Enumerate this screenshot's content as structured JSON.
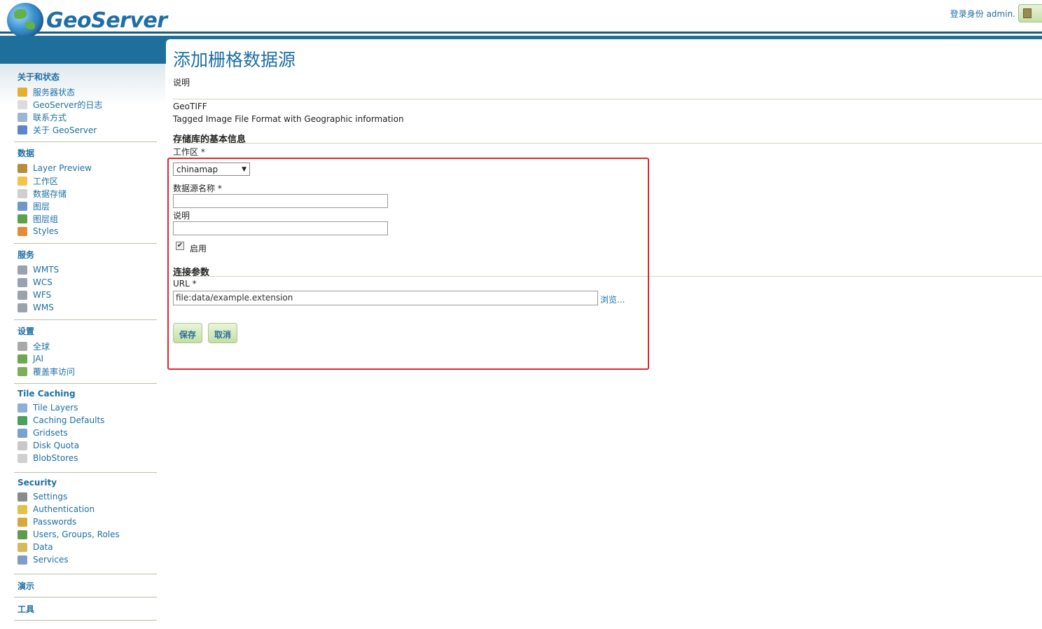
{
  "header": {
    "logo_text": "GeoServer",
    "login_text": "登录身份 admin."
  },
  "page": {
    "title": "添加栅格数据源",
    "description_label": "说明",
    "format_name": "GeoTIFF",
    "format_description": "Tagged Image File Format with Geographic information"
  },
  "form": {
    "basic_info_heading": "存储库的基本信息",
    "workspace_label": "工作区 *",
    "workspace_value": "chinamap",
    "datasource_name_label": "数据源名称 *",
    "datasource_name_value": "",
    "description_label": "说明",
    "description_value": "",
    "enabled_label": "启用",
    "enabled_checked": true,
    "connection_heading": "连接参数",
    "url_label": "URL *",
    "url_value": "file:data/example.extension",
    "browse_label": "浏览...",
    "save_label": "保存",
    "cancel_label": "取消"
  },
  "sidebar": {
    "sections": [
      {
        "title": "关于和状态",
        "items": [
          {
            "label": "服务器状态",
            "icon": "server-status-icon"
          },
          {
            "label": "GeoServer的日志",
            "icon": "log-icon"
          },
          {
            "label": "联系方式",
            "icon": "contact-icon"
          },
          {
            "label": "关于 GeoServer",
            "icon": "about-icon"
          }
        ]
      },
      {
        "title": "数据",
        "items": [
          {
            "label": "Layer Preview",
            "icon": "layer-preview-icon"
          },
          {
            "label": "工作区",
            "icon": "folder-icon"
          },
          {
            "label": "数据存储",
            "icon": "database-icon"
          },
          {
            "label": "图层",
            "icon": "layer-icon"
          },
          {
            "label": "图层组",
            "icon": "layergroup-icon"
          },
          {
            "label": "Styles",
            "icon": "styles-icon"
          }
        ]
      },
      {
        "title": "服务",
        "items": [
          {
            "label": "WMTS",
            "icon": "service-icon"
          },
          {
            "label": "WCS",
            "icon": "service-icon"
          },
          {
            "label": "WFS",
            "icon": "service-icon"
          },
          {
            "label": "WMS",
            "icon": "service-icon"
          }
        ]
      },
      {
        "title": "设置",
        "items": [
          {
            "label": "全球",
            "icon": "global-settings-icon"
          },
          {
            "label": "JAI",
            "icon": "jai-icon"
          },
          {
            "label": "覆盖率访问",
            "icon": "coverage-access-icon"
          }
        ]
      },
      {
        "title": "Tile Caching",
        "items": [
          {
            "label": "Tile Layers",
            "icon": "tile-layers-icon"
          },
          {
            "label": "Caching Defaults",
            "icon": "globe-grid-icon"
          },
          {
            "label": "Gridsets",
            "icon": "gridsets-icon"
          },
          {
            "label": "Disk Quota",
            "icon": "disk-icon"
          },
          {
            "label": "BlobStores",
            "icon": "blobstore-icon"
          }
        ]
      },
      {
        "title": "Security",
        "items": [
          {
            "label": "Settings",
            "icon": "wrench-icon"
          },
          {
            "label": "Authentication",
            "icon": "shield-icon"
          },
          {
            "label": "Passwords",
            "icon": "lock-icon"
          },
          {
            "label": "Users, Groups, Roles",
            "icon": "users-icon"
          },
          {
            "label": "Data",
            "icon": "data-security-icon"
          },
          {
            "label": "Services",
            "icon": "services-security-icon"
          }
        ]
      },
      {
        "title": "演示",
        "items": []
      },
      {
        "title": "工具",
        "items": []
      }
    ]
  },
  "colors": {
    "brand_blue": "#1d6fa5",
    "band_blue": "#1f6f9c",
    "highlight_red": "#e4262c",
    "button_green": "#c4dfa6"
  }
}
